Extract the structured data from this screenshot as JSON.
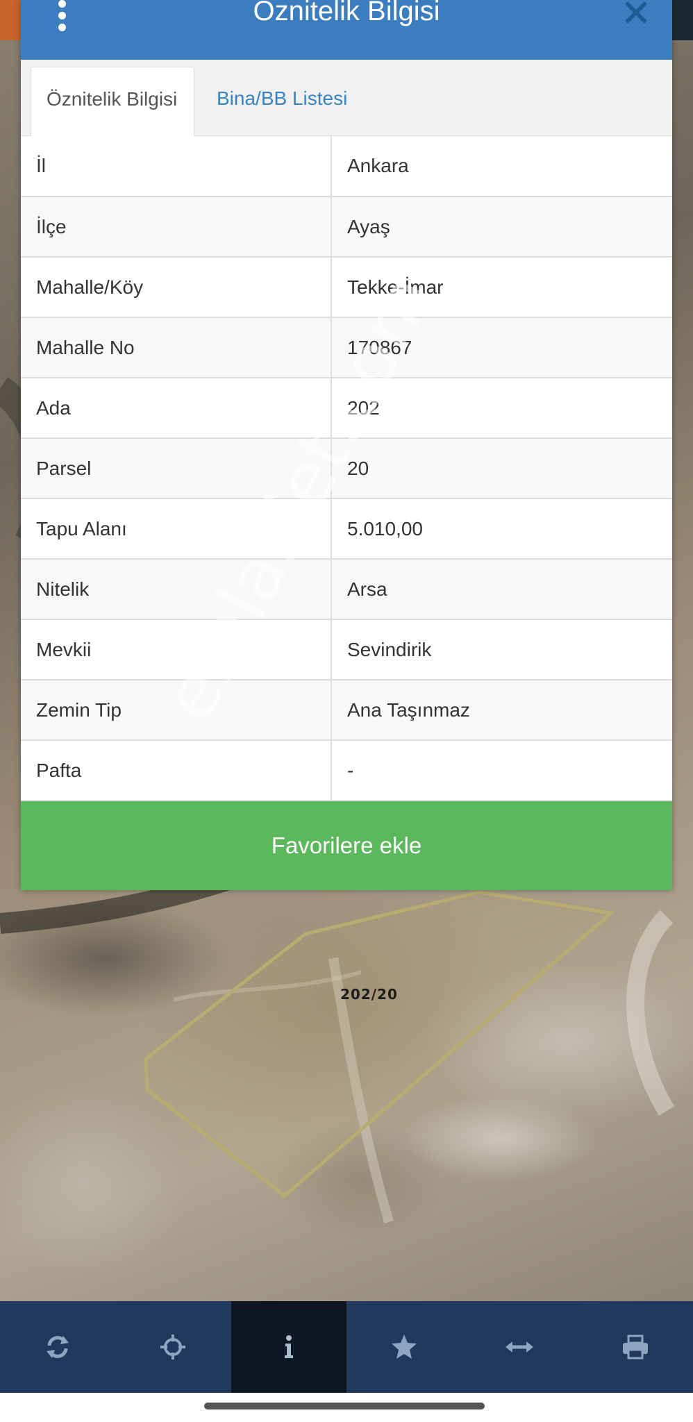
{
  "header": {
    "title": "Öznitelik Bilgisi"
  },
  "tabs": [
    {
      "label": "Öznitelik Bilgisi",
      "active": true
    },
    {
      "label": "Bina/BB Listesi",
      "active": false
    }
  ],
  "attributes": [
    {
      "key": "İl",
      "value": "Ankara"
    },
    {
      "key": "İlçe",
      "value": "Ayaş"
    },
    {
      "key": "Mahalle/Köy",
      "value": "Tekke-İmar"
    },
    {
      "key": "Mahalle No",
      "value": "170867"
    },
    {
      "key": "Ada",
      "value": "202"
    },
    {
      "key": "Parsel",
      "value": "20"
    },
    {
      "key": "Tapu Alanı",
      "value": "5.010,00"
    },
    {
      "key": "Nitelik",
      "value": "Arsa"
    },
    {
      "key": "Mevkii",
      "value": "Sevindirik"
    },
    {
      "key": "Zemin Tip",
      "value": "Ana Taşınmaz"
    },
    {
      "key": "Pafta",
      "value": "-"
    }
  ],
  "favorite_button": {
    "label": "Favorilere ekle"
  },
  "watermark": "emlakjet.com",
  "map": {
    "parcel_label": "202/20"
  },
  "bottom_nav": [
    {
      "icon": "refresh-icon",
      "active": false
    },
    {
      "icon": "crosshair-icon",
      "active": false
    },
    {
      "icon": "info-icon",
      "active": true
    },
    {
      "icon": "star-icon",
      "active": false
    },
    {
      "icon": "measure-icon",
      "active": false
    },
    {
      "icon": "print-icon",
      "active": false
    }
  ],
  "colors": {
    "header": "#3b7dbf",
    "tab_link": "#3b84c4",
    "favorite": "#5cb85c",
    "nav_bar": "#1f3a5c",
    "nav_active": "#0d1622"
  }
}
